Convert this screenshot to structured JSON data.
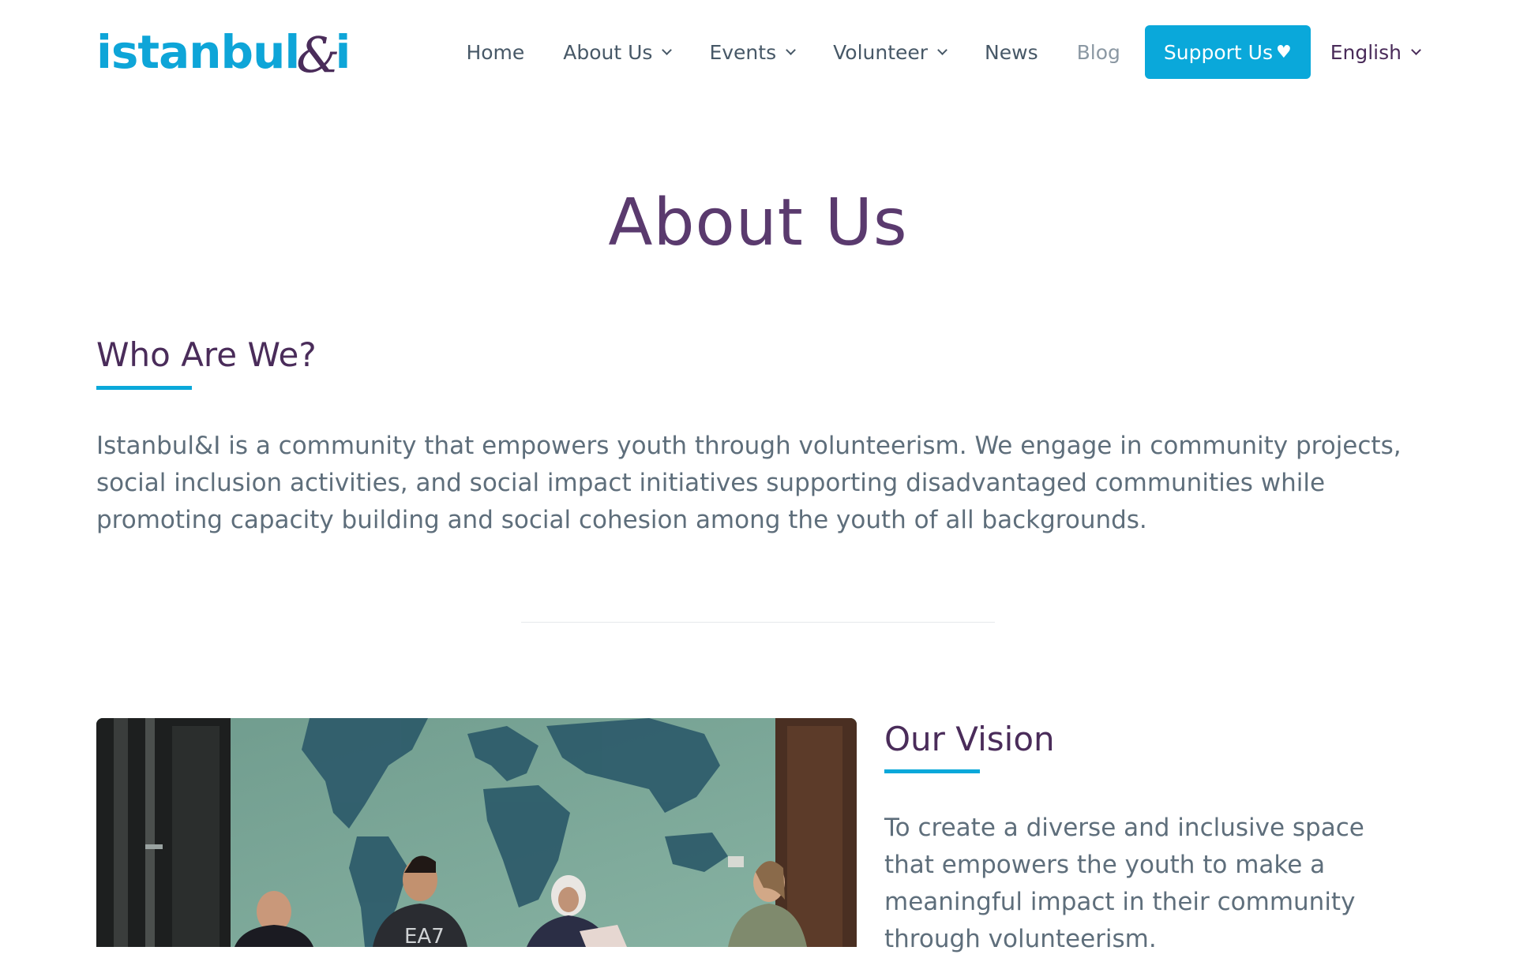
{
  "header": {
    "logo": {
      "part1": "istanbul",
      "amp": "&",
      "part2": "i"
    },
    "nav": {
      "home": "Home",
      "about": "About Us",
      "events": "Events",
      "volunteer": "Volunteer",
      "news": "News",
      "blog": "Blog",
      "support": "Support Us",
      "support_icon": "♥",
      "language": "English"
    }
  },
  "page": {
    "title": "About Us"
  },
  "who": {
    "heading": "Who Are We?",
    "text": "Istanbul&I is a community that empowers youth through volunteerism. We engage in community projects, social inclusion activities, and social impact initiatives supporting disadvantaged communities while promoting capacity building and social cohesion among the youth of all backgrounds."
  },
  "vision": {
    "heading": "Our Vision",
    "text": "To create a diverse and inclusive space that empowers the youth to make a meaningful impact in their community through volunteerism."
  },
  "colors": {
    "brand_blue": "#0aa8da",
    "brand_purple": "#4a2c5a",
    "body_text": "#5e6e7b"
  }
}
